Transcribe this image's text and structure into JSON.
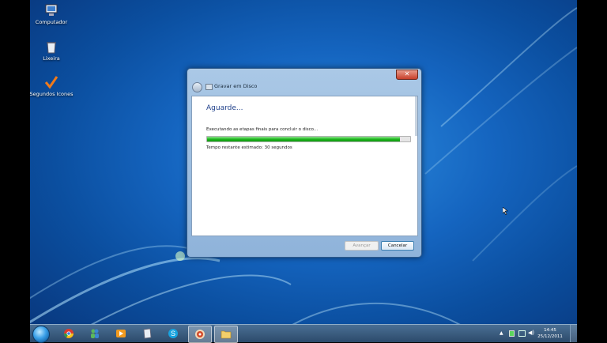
{
  "desktop": {
    "icons": [
      {
        "label": "Computador",
        "icon": "computer-icon"
      },
      {
        "label": "Lixeira",
        "icon": "recycle-bin-icon"
      },
      {
        "label": "Segundos Icones",
        "icon": "checkmark-icon"
      }
    ]
  },
  "dialog": {
    "title": "Gravar em Disco",
    "heading": "Aguarde...",
    "status_text": "Executando as etapas finais para concluir o disco...",
    "progress": 0.95,
    "time_remaining": "Tempo restante estimado: 30 segundos",
    "next_label": "Avançar",
    "cancel_label": "Cancelar",
    "close_glyph": "✕"
  },
  "taskbar": {
    "items": [
      "explorer-icon",
      "chrome-icon",
      "messenger-icon",
      "media-player-icon",
      "notepad-icon",
      "skype-icon",
      "burn-icon",
      "folder-icon"
    ],
    "clock_time": "14:45",
    "clock_date": "25/12/2011"
  },
  "colors": {
    "heading": "#1e3f8a",
    "progress_fill": "#1cb41c",
    "close_button": "#c7402b"
  }
}
